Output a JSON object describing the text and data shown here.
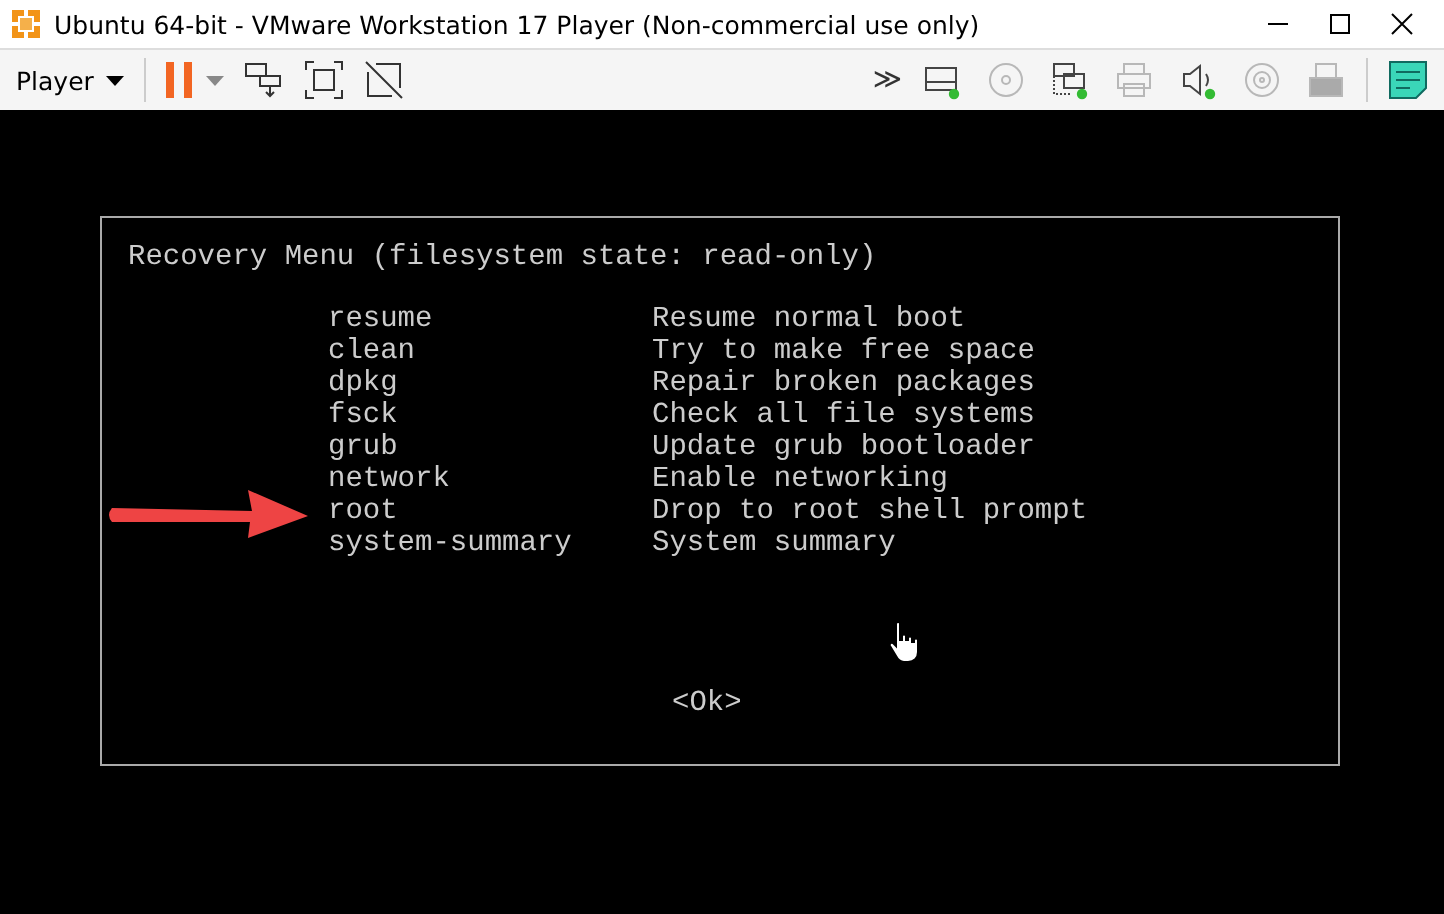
{
  "window": {
    "title": "Ubuntu 64-bit - VMware Workstation 17 Player (Non-commercial use only)"
  },
  "toolbar": {
    "menu_label": "Player",
    "more": "≫",
    "devices": [
      {
        "kind": "hdd",
        "connected": true
      },
      {
        "kind": "cd",
        "connected": false
      },
      {
        "kind": "network",
        "connected": true
      },
      {
        "kind": "printer",
        "connected": false
      },
      {
        "kind": "sound",
        "connected": true
      },
      {
        "kind": "disc",
        "connected": false
      },
      {
        "kind": "usb",
        "connected": false
      }
    ]
  },
  "recovery_menu": {
    "title": "Recovery Menu (filesystem state: read-only)",
    "items": [
      {
        "command": "resume",
        "description": "Resume normal boot",
        "selected": false
      },
      {
        "command": "clean",
        "description": "Try to make free space",
        "selected": false
      },
      {
        "command": "dpkg",
        "description": "Repair broken packages",
        "selected": false
      },
      {
        "command": "fsck",
        "description": "Check all file systems",
        "selected": false
      },
      {
        "command": "grub",
        "description": "Update grub bootloader",
        "selected": false
      },
      {
        "command": "network",
        "description": "Enable networking",
        "selected": false
      },
      {
        "command": "root",
        "description": "Drop to root shell prompt",
        "selected": false
      },
      {
        "command": "system-summary",
        "description": "System summary",
        "selected": false
      }
    ],
    "button": "<Ok>"
  }
}
